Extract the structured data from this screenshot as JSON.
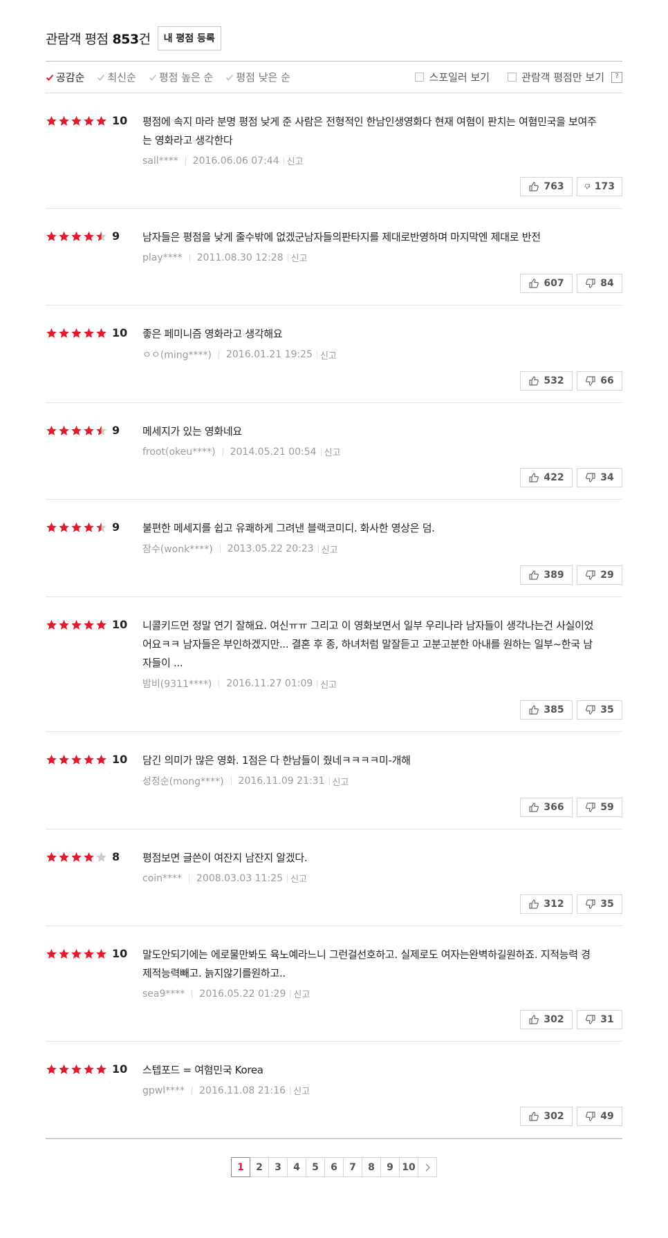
{
  "header": {
    "title": "관람객 평점",
    "count": "853",
    "unit": "건",
    "register_btn": "내 평점 등록"
  },
  "sort": [
    {
      "label": "공감순",
      "active": true
    },
    {
      "label": "최신순",
      "active": false
    },
    {
      "label": "평점 높은 순",
      "active": false
    },
    {
      "label": "평점 낮은 순",
      "active": false
    }
  ],
  "options": {
    "spoiler": "스포일러 보기",
    "audience_only": "관람객 평점만 보기",
    "help": "?"
  },
  "colors": {
    "star_on": "#e31a2b",
    "star_off": "#cccccc",
    "active_check": "#e31a2b"
  },
  "reviews": [
    {
      "stars": 5,
      "score": "10",
      "text": "평점에 속지 마라 분명 평점 낮게 준 사람은 전형적인 한남인생영화다 현재 여혐이 판치는 여혐민국을 보여주는 영화라고 생각한다",
      "user": "sall****",
      "date": "2016.06.06 07:44",
      "report": "신고",
      "up": "763",
      "down": "173"
    },
    {
      "stars": 4.5,
      "score": "9",
      "text": "남자들은 평점을 낮게 줄수밖에 없겠군남자들의판타지를 제대로반영하며 마지막엔 제대로 반전",
      "user": "play****",
      "date": "2011.08.30 12:28",
      "report": "신고",
      "up": "607",
      "down": "84"
    },
    {
      "stars": 5,
      "score": "10",
      "text": "좋은 페미니즘 영화라고 생각해요",
      "user": "ㅇㅇ(ming****)",
      "date": "2016.01.21 19:25",
      "report": "신고",
      "up": "532",
      "down": "66"
    },
    {
      "stars": 4.5,
      "score": "9",
      "text": "메세지가 있는 영화네요",
      "user": "froot(okeu****)",
      "date": "2014.05.21 00:54",
      "report": "신고",
      "up": "422",
      "down": "34"
    },
    {
      "stars": 4.5,
      "score": "9",
      "text": "불편한 메세지를 쉽고 유쾌하게 그려낸 블랙코미디. 화사한 영상은 덤.",
      "user": "잠수(wonk****)",
      "date": "2013.05.22 20:23",
      "report": "신고",
      "up": "389",
      "down": "29"
    },
    {
      "stars": 5,
      "score": "10",
      "text": "니콜키드먼 정말 연기 잘해요. 여신ㅠㅠ 그리고 이 영화보면서 일부 우리나라 남자들이 생각나는건 사실이었어요ㅋㅋ 남자들은 부인하겠지만... 결혼 후 종, 하녀처럼 말잘듣고 고분고분한 아내를 원하는 일부~한국 남자들이 ...",
      "user": "밤비(9311****)",
      "date": "2016.11.27 01:09",
      "report": "신고",
      "up": "385",
      "down": "35"
    },
    {
      "stars": 5,
      "score": "10",
      "text": "담긴 의미가 많은 영화. 1점은 다 한남들이 줬네ㅋㅋㅋㅋ미-개해",
      "user": "성정순(mong****)",
      "date": "2016.11.09 21:31",
      "report": "신고",
      "up": "366",
      "down": "59"
    },
    {
      "stars": 4,
      "score": "8",
      "text": "평점보면 글쓴이 여잔지 남잔지 알겠다.",
      "user": "coin****",
      "date": "2008.03.03 11:25",
      "report": "신고",
      "up": "312",
      "down": "35"
    },
    {
      "stars": 5,
      "score": "10",
      "text": "말도안되기에는 에로물만봐도 육노예라느니 그런걸선호하고. 실제로도 여자는완벽하길원하죠. 지적능력 경제적능력빼고. 늙지않기를원하고..",
      "user": "sea9****",
      "date": "2016.05.22 01:29",
      "report": "신고",
      "up": "302",
      "down": "31"
    },
    {
      "stars": 5,
      "score": "10",
      "text": "스텝포드 = 여혐민국 Korea",
      "user": "gpwl****",
      "date": "2016.11.08 21:16",
      "report": "신고",
      "up": "302",
      "down": "49"
    }
  ],
  "pagination": {
    "current": "1",
    "pages": [
      "1",
      "2",
      "3",
      "4",
      "5",
      "6",
      "7",
      "8",
      "9",
      "10"
    ],
    "next_icon": "chevron-right-icon"
  }
}
